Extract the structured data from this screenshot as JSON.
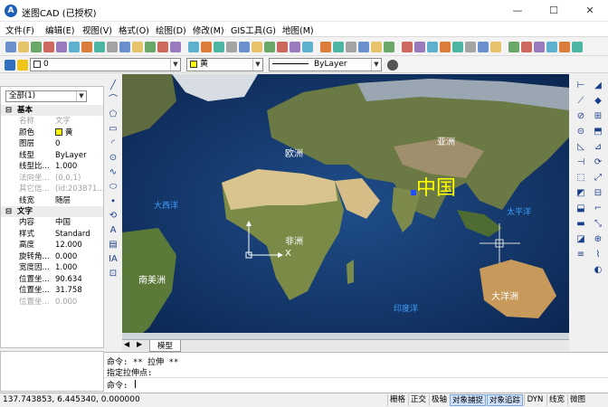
{
  "window": {
    "title": "迷图CAD (已授权)",
    "app_icon": "A",
    "minimize": "—",
    "maximize": "☐",
    "close": "✕"
  },
  "menu": [
    "文件(F)",
    "编辑(E)",
    "视图(V)",
    "格式(O)",
    "绘图(D)",
    "修改(M)",
    "GIS工具(G)",
    "地图(M)"
  ],
  "layer_bar": {
    "layer_value": "0",
    "color_value": "黄",
    "linetype_value": "ByLayer"
  },
  "props": {
    "filter": "全部(1)",
    "sections": [
      {
        "title": "基本",
        "rows": [
          {
            "k": "名称",
            "v": "文字",
            "grey": true
          },
          {
            "k": "颜色",
            "v": "黄",
            "swatch": "#ffff00"
          },
          {
            "k": "图层",
            "v": "0"
          },
          {
            "k": "线型",
            "v": "ByLayer"
          },
          {
            "k": "线型比...",
            "v": "1.000"
          },
          {
            "k": "法向坐...",
            "v": "(0,0,1)",
            "grey": true
          },
          {
            "k": "其它信...",
            "v": "(id:203871...",
            "grey": true
          },
          {
            "k": "线宽",
            "v": "随层"
          }
        ]
      },
      {
        "title": "文字",
        "rows": [
          {
            "k": "内容",
            "v": "中国"
          },
          {
            "k": "样式",
            "v": "Standard"
          },
          {
            "k": "高度",
            "v": "12.000"
          },
          {
            "k": "旋转角...",
            "v": "0.000"
          },
          {
            "k": "宽度因...",
            "v": "1.000"
          },
          {
            "k": "位置坐...",
            "v": "90.634"
          },
          {
            "k": "位置坐...",
            "v": "31.758"
          },
          {
            "k": "位置坐...",
            "v": "0.000",
            "grey": true
          }
        ]
      }
    ]
  },
  "map": {
    "labels": {
      "europe": "欧洲",
      "asia": "亚洲",
      "africa": "非洲",
      "south_america": "南美洲",
      "oceania": "大洋洲",
      "atlantic": "大西洋",
      "pacific": "太平洋",
      "indian": "印度洋",
      "china": "中国",
      "axis_x": "X",
      "axis_y": "Y"
    }
  },
  "tabs": {
    "prev": "◀",
    "next": "▶",
    "model": "模型"
  },
  "command": {
    "line1": "命令: ** 拉伸 **",
    "line2": "指定拉伸点:",
    "line3": "命令:"
  },
  "status": {
    "coords": "137.743853, 6.445340, 0.000000",
    "buttons": [
      {
        "label": "栅格",
        "on": false
      },
      {
        "label": "正交",
        "on": false
      },
      {
        "label": "极轴",
        "on": false
      },
      {
        "label": "对象捕捉",
        "on": true
      },
      {
        "label": "对象追踪",
        "on": true
      },
      {
        "label": "DYN",
        "on": false
      },
      {
        "label": "线宽",
        "on": false
      },
      {
        "label": "微图",
        "on": false
      }
    ]
  }
}
